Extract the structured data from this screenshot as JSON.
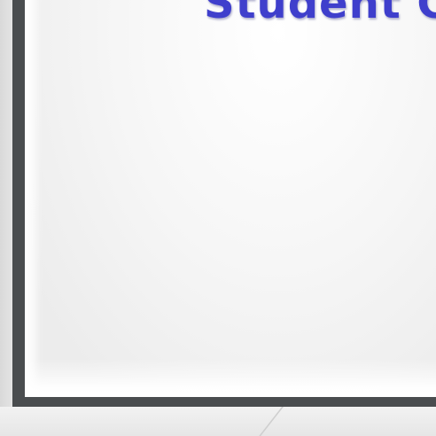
{
  "sign": {
    "title_text": "Student C",
    "title_color": "#3f3fcc",
    "frame_color": "#4a4d4f",
    "face_color": "#f0f0f0"
  }
}
